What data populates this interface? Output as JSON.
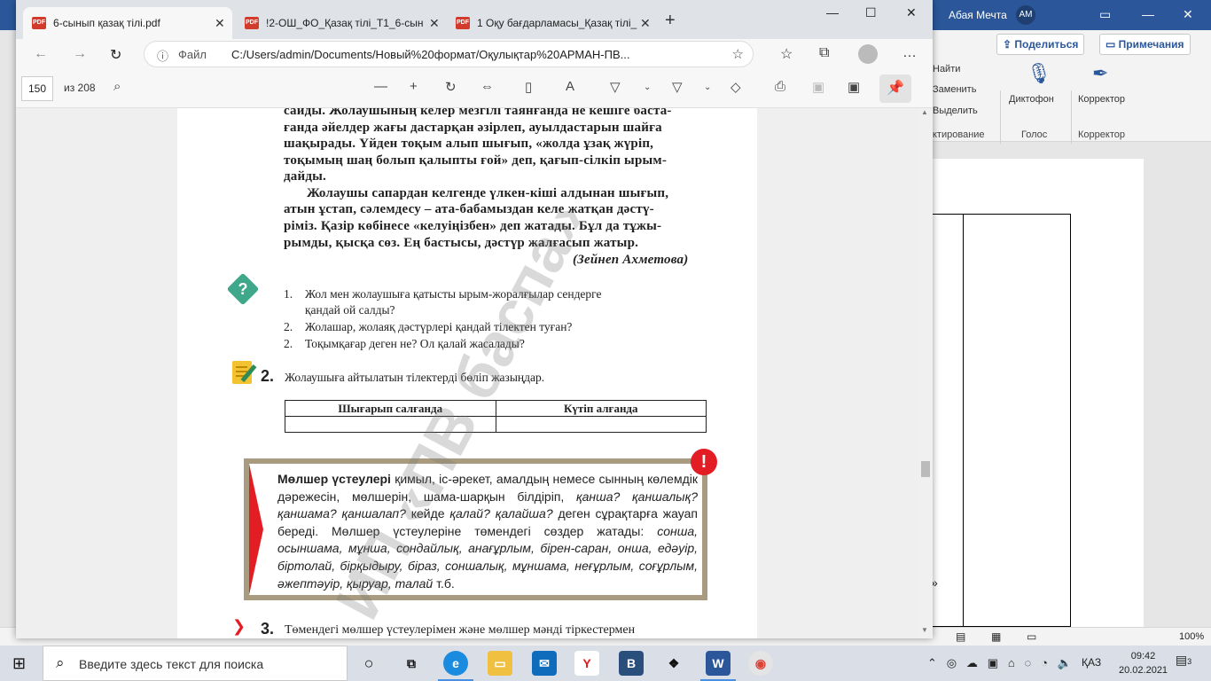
{
  "word": {
    "user": "Абая Мечта",
    "initials": "АМ",
    "share_label": "Поделиться",
    "notes_label": "Примечания",
    "find_label": "Найти",
    "replace_label": "Заменить",
    "select_label": "Выделить",
    "edit_group": "ктирование",
    "dictate_label": "Диктофон",
    "voice_group": "Голос",
    "editor_label": "Корректор",
    "editor_group": "Корректор",
    "zoom": "100%",
    "chevron": "»"
  },
  "browser": {
    "tabs": [
      {
        "label": "6-сынып қазақ тілі.pdf",
        "active": true
      },
      {
        "label": "!2-ОШ_ФО_Қазақ тілі_Т1_6-сын",
        "active": false
      },
      {
        "label": "1 Оқу бағдарламасы_Қазақ тілі_",
        "active": false
      }
    ],
    "scheme": "Файл",
    "url": "C:/Users/admin/Documents/Новый%20формат/Оқулықтар%20АРМАН-ПВ..."
  },
  "pdf": {
    "page_number": "150",
    "page_count": "из 208"
  },
  "page": {
    "lines": [
      "саиды. Жолаушының келер мезгілі таянғанда не кешіге баста-",
      "ғанда әйелдер жағы дастарқан әзірлеп, ауылдастарын шайға",
      "шақырады. Үйден тоқым алып шығып, «жолда ұзақ жүріп,",
      "тоқымың шаң болып қалыпты ғой» деп, қағып-сілкіп ырым-",
      "дайды.",
      "Жолаушы сапардан келгенде үлкен-кіші алдынан шығып,",
      "атын ұстап, сәлемдесу – ата-бабамыздан келе жатқан дәстү-",
      "ріміз. Қазір көбінесе «келуіңізбен» деп жатады. Бұл да тұжы-",
      "рымды, қысқа сөз. Ең бастысы, дәстүр жалғасып жатыр."
    ],
    "author": "(Зейнеп Ахметова)",
    "q_icon": "?",
    "questions": [
      {
        "num": "1.",
        "line1": "Жол мен жолаушыға қатысты ырым-жоралғылар сендерге",
        "line2": "қандай ой салды?"
      },
      {
        "num": "2.",
        "line1": "Жолашар, жолаяқ дәстүрлері қандай тілектен туған?"
      },
      {
        "num": "2.",
        "line1": "Тоқымқағар деген не? Ол қалай жасалады?"
      }
    ],
    "task2_num": "2.",
    "task2_text": "Жолаушыға айтылатын тілектерді бөліп жазыңдар.",
    "table_headers": [
      "Шығарып салғанда",
      "Күтіп алғанда"
    ],
    "rule_title": "Мөлшер үстеулері",
    "rule_part1": " қимыл, іс-әрекет, амалдың немесе сынның көлемдік дәрежесін, мөлшерін, шама-шарқын білдіріп, ",
    "rule_q": "қанша? қаншалық? қаншама? қаншалап?",
    "rule_part2": " кейде ",
    "rule_q2": "қалай? қалайша?",
    "rule_part3": " деген сұрақтарға жауап береді. Мөлшер үстеулеріне төмендегі сөздер жатады: ",
    "rule_words": "сонша, осыншама, мұнша, сондайлық, анағұрлым, бірен-саран, онша, едәуір, біртолай, бірқыдыру, біраз, соншалық, мұншама, неғұрлым, соғұрлым, әжептәуір, қыруар, талай",
    "rule_end": " т.б.",
    "excl": "!",
    "task3_num": "3.",
    "task3_text": "Төмендегі мөлшер үстеулерімен және мөлшер мәнді тіркестермен",
    "watermark": "ИП «ПВ баспа»"
  },
  "taskbar": {
    "search_placeholder": "Введите здесь текст для поиска",
    "lang": "ҚАЗ",
    "time": "09:42",
    "date": "20.02.2021",
    "notif_count": "3"
  }
}
